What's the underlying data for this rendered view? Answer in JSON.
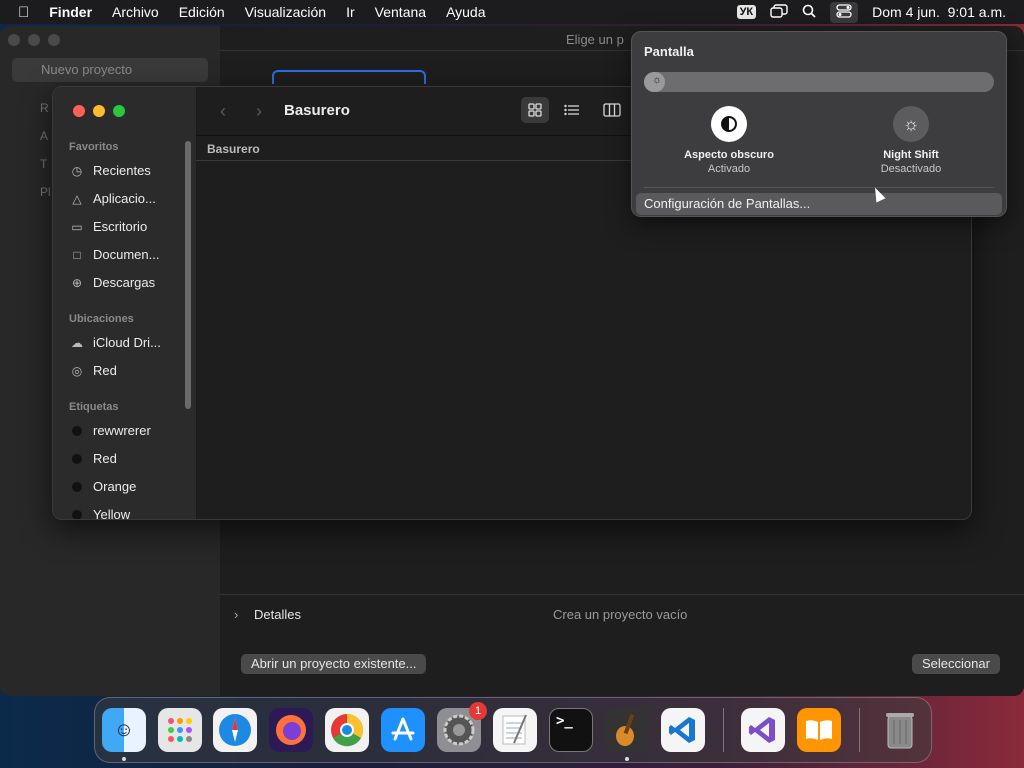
{
  "menubar": {
    "app": "Finder",
    "menus": [
      "Archivo",
      "Edición",
      "Visualización",
      "Ir",
      "Ventana",
      "Ayuda"
    ],
    "keyboard": "УК",
    "clock": "Dom 4 jun.  9:01 a.m."
  },
  "background_window": {
    "title": "Elige un p",
    "sidebar_selected": "Nuevo proyecto",
    "sidebar_letters": [
      "R",
      "A",
      "T",
      "Pl"
    ],
    "details_label": "Detalles",
    "details_desc": "Crea un proyecto vacío",
    "open_button": "Abrir un proyecto existente...",
    "select_button": "Seleccionar"
  },
  "finder": {
    "title": "Basurero",
    "column_header": "Basurero",
    "sections": {
      "favorites": "Favoritos",
      "locations": "Ubicaciones",
      "tags": "Etiquetas"
    },
    "favorites": [
      {
        "label": "Recientes",
        "icon": "clock-icon"
      },
      {
        "label": "Aplicacio...",
        "icon": "apps-icon"
      },
      {
        "label": "Escritorio",
        "icon": "desktop-icon"
      },
      {
        "label": "Documen...",
        "icon": "document-icon"
      },
      {
        "label": "Descargas",
        "icon": "download-icon"
      }
    ],
    "locations": [
      {
        "label": "iCloud Dri...",
        "icon": "cloud-icon"
      },
      {
        "label": "Red",
        "icon": "network-icon"
      }
    ],
    "tags": [
      "rewwrerer",
      "Red",
      "Orange",
      "Yellow"
    ]
  },
  "control_center": {
    "title": "Pantalla",
    "brightness": 0.05,
    "dark_mode_label": "Aspecto obscuro",
    "dark_mode_state": "Activado",
    "night_shift_label": "Night Shift",
    "night_shift_state": "Desactivado",
    "settings_link": "Configuración de Pantallas..."
  },
  "dock": {
    "apps": [
      "Finder",
      "Launchpad",
      "Safari",
      "Firefox",
      "Chrome",
      "App Store",
      "Configuración del Sistema",
      "TextEdit",
      "Terminal",
      "GarageBand",
      "Visual Studio Code",
      "Visual Studio",
      "Libros",
      "Papelera"
    ],
    "badge": "1"
  }
}
